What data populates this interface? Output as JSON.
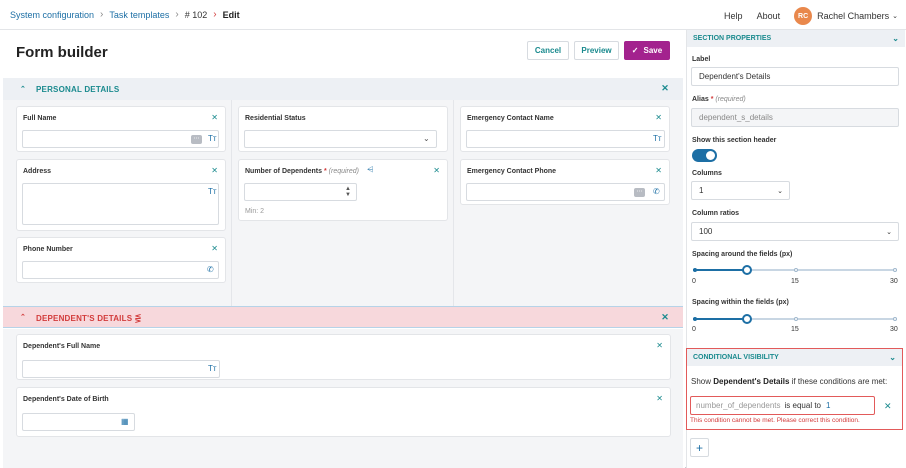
{
  "breadcrumb": {
    "items": [
      "System configuration",
      "Task templates",
      "# 102",
      "Edit"
    ]
  },
  "top_nav": {
    "help": "Help",
    "about": "About",
    "user_initials": "RC",
    "user_name": "Rachel Chambers"
  },
  "page": {
    "title": "Form builder",
    "cancel": "Cancel",
    "preview": "Preview",
    "save": "Save"
  },
  "sections": {
    "personal": {
      "label": "PERSONAL DETAILS"
    },
    "dependent": {
      "label": "DEPENDENT'S DETAILS"
    }
  },
  "fields": {
    "full_name": {
      "label": "Full Name"
    },
    "address": {
      "label": "Address"
    },
    "phone": {
      "label": "Phone Number"
    },
    "residential": {
      "label": "Residential Status"
    },
    "num_dependents": {
      "label": "Number of Dependents",
      "required_text": "(required)",
      "hint": "Min: 2"
    },
    "emergency_name": {
      "label": "Emergency Contact Name"
    },
    "emergency_phone": {
      "label": "Emergency Contact Phone"
    },
    "dep_full_name": {
      "label": "Dependent's Full Name"
    },
    "dep_dob": {
      "label": "Dependent's Date of Birth"
    }
  },
  "panel": {
    "section_properties": "SECTION PROPERTIES",
    "label_title": "Label",
    "label_value": "Dependent's Details",
    "alias_title": "Alias",
    "alias_required": "(required)",
    "alias_value": "dependent_s_details",
    "show_header": "Show this section header",
    "columns_title": "Columns",
    "columns_value": "1",
    "ratios_title": "Column ratios",
    "ratios_value": "100",
    "spacing_around": "Spacing around the fields (px)",
    "spacing_around_value": 8,
    "spacing_within": "Spacing within the fields (px)",
    "spacing_within_value": 8,
    "ticks": [
      "0",
      "15",
      "30"
    ],
    "slider_range": [
      0,
      30
    ]
  },
  "conditional": {
    "header": "CONDITIONAL VISIBILITY",
    "text_prefix": "Show",
    "section_name": "Dependent's Details",
    "text_suffix": "if these conditions are met:",
    "variable": "number_of_dependents",
    "operator": "is equal to",
    "value": "1",
    "error": "This condition cannot be met. Please correct this condition."
  },
  "colors": {
    "teal": "#1a8a8e",
    "blue": "#1d6fa5",
    "save": "#a3228e",
    "error": "#d23b3b",
    "avatar": "#e9884c"
  }
}
